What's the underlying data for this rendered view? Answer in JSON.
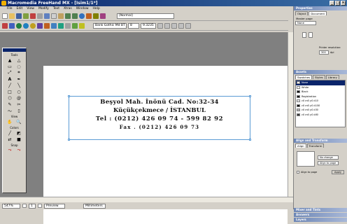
{
  "window": {
    "title": "Macromedia FreeHand MX - [Isim1/1*]"
  },
  "menu": [
    "File",
    "Edit",
    "View",
    "Modify",
    "Text",
    "Xtras",
    "Window",
    "Help"
  ],
  "toolbar": {
    "style_select": "[Normal]",
    "font_select": "Bank Gothic Md BT",
    "size_select": "8",
    "leading_select": "9.3235"
  },
  "tools_panel": {
    "title": "Tools",
    "sections": [
      "View",
      "Colors",
      "Snap"
    ]
  },
  "document": {
    "lines": [
      "Beşyol Mah. İnönü Cad. No:32-34",
      "Küçükçekmece / İSTANBUL",
      "Tel : (0212) 426 09 74 - 599 82 92",
      "Fax . (0212) 426 09 73"
    ]
  },
  "status": {
    "zoom": "547%",
    "page": "1",
    "view_mode": "Preview",
    "units": "Millimeters"
  },
  "properties_panel": {
    "title": "Properties",
    "tabs": [
      "Object",
      "Document"
    ],
    "master_page_label": "Master page",
    "master_page": "None",
    "printer_label": "Printer resolution:",
    "printer_value": "300",
    "dpi": "dpi"
  },
  "assets_panel": {
    "title": "Assets",
    "tabs": [
      "Swatches",
      "Styles",
      "Library"
    ],
    "swatches": [
      "None",
      "White",
      "Black",
      "Registration",
      "c0 m0 y0 k10",
      "c0 m0 y0 k100",
      "c0 m0 y0 k30",
      "c0 m0 y0 k80"
    ]
  },
  "align_panel": {
    "title": "Align and Transform",
    "tabs": [
      "Align",
      "Transform"
    ],
    "align_select": "No change",
    "align_to": "Align to page",
    "to_page": "Align to page",
    "apply": "Apply"
  },
  "collapsed_panels": [
    "Mixer and Tints",
    "Answers",
    "Layers"
  ],
  "colors": {
    "title_bar": "#0a246a",
    "selection": "#5b9bd5",
    "panel_header": "#6d86b5"
  }
}
